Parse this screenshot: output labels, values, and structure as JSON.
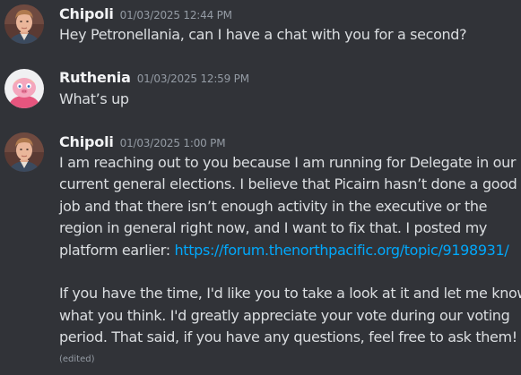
{
  "messages": [
    {
      "author": "Chipoli",
      "timestamp": "01/03/2025 12:44 PM",
      "lines": [
        "Hey Petronellania, can I have a chat with you for a second?"
      ]
    },
    {
      "author": "Ruthenia",
      "timestamp": "01/03/2025 12:59 PM",
      "lines": [
        "What’s up"
      ]
    },
    {
      "author": "Chipoli",
      "timestamp": "01/03/2025 1:00 PM",
      "lines": [
        "I am reaching out to you because I am running for Delegate in our",
        "current general elections. I believe that Picairn hasn’t done a good",
        "job and that there isn’t enough activity in the executive or the",
        "region in general right now, and I want to fix that. I posted my"
      ],
      "link_prefix": "platform earlier: ",
      "link": "https://forum.thenorthpacific.org/topic/9198931/",
      "lines_after": [
        "If you have the time, I'd like you to take a look at it and let me know",
        "what you think. I'd greatly appreciate your vote during our voting",
        "period. That said, if you have any questions, feel free to ask them!"
      ],
      "edited_label": "(edited)"
    }
  ],
  "avatars": {
    "chipoli": "man-portrait-avatar",
    "ruthenia": "pink-puppet-avatar"
  },
  "colors": {
    "background": "#313338",
    "username": "#f2f3f5",
    "text": "#dbdee1",
    "muted": "#949ba4",
    "link": "#00a8fc"
  }
}
